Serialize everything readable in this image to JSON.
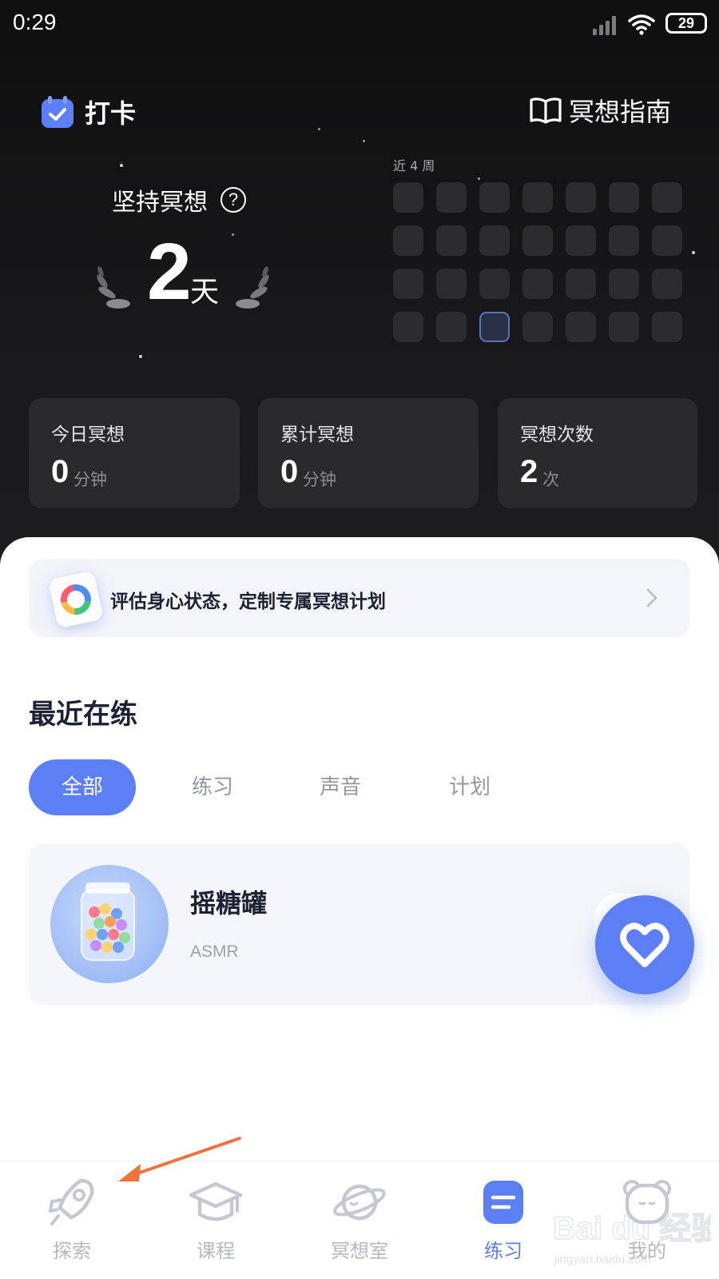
{
  "status_bar": {
    "time": "0:29",
    "battery": "29"
  },
  "header": {
    "checkin_label": "打卡",
    "guide_label": "冥想指南"
  },
  "streak": {
    "label": "坚持冥想",
    "help_symbol": "?",
    "days": "2",
    "unit": "天"
  },
  "calendar": {
    "label": "近 4 周",
    "rows": 4,
    "cols": 7,
    "active_cell": {
      "row": 3,
      "col": 2
    }
  },
  "stats": [
    {
      "title": "今日冥想",
      "value": "0",
      "unit": "分钟"
    },
    {
      "title": "累计冥想",
      "value": "0",
      "unit": "分钟"
    },
    {
      "title": "冥想次数",
      "value": "2",
      "unit": "次"
    }
  ],
  "banner": {
    "text": "评估身心状态，定制专属冥想计划"
  },
  "recent": {
    "title": "最近在练",
    "tabs": [
      "全部",
      "练习",
      "声音",
      "计划"
    ],
    "active_tab": "全部",
    "items": [
      {
        "title": "摇糖罐",
        "subtitle": "ASMR"
      }
    ]
  },
  "nav": {
    "items": [
      {
        "label": "探索",
        "icon": "rocket-icon"
      },
      {
        "label": "课程",
        "icon": "graduation-cap-icon"
      },
      {
        "label": "冥想室",
        "icon": "planet-icon"
      },
      {
        "label": "练习",
        "icon": "practice-icon",
        "active": true
      },
      {
        "label": "我的",
        "icon": "bear-icon"
      }
    ]
  },
  "watermark": {
    "brand_text": "Bai du 经验",
    "url_text": "jingyan.baidu.com"
  },
  "colors": {
    "accent": "#5d7ff5",
    "dark_bg": "#151517",
    "card_dark": "#2a2a2d",
    "annotation_arrow": "#f0743a"
  }
}
